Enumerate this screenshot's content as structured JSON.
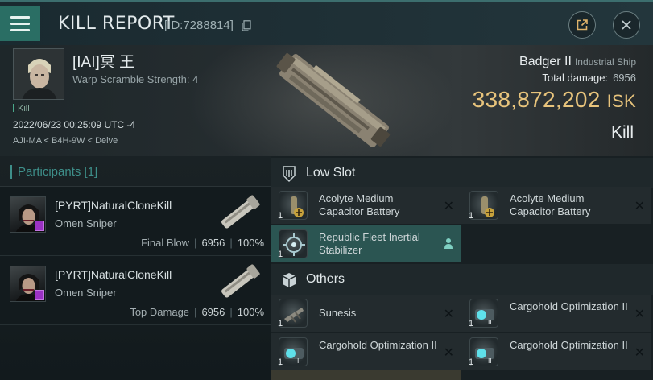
{
  "header": {
    "title": "KILL REPORT",
    "id_label": "[ID:7288814]"
  },
  "victim": {
    "name": "[IAI]冥 王",
    "subtitle": "Warp Scramble Strength: 4",
    "tag": "Kill",
    "date": "2022/06/23 00:25:09 UTC -4",
    "location": "AJI-MA < B4H-9W < Delve"
  },
  "ship": {
    "name": "Badger II",
    "class": "Industrial Ship",
    "total_damage_label": "Total damage:",
    "total_damage": "6956",
    "isk_value": "338,872,202",
    "isk_unit": "ISK",
    "result": "Kill"
  },
  "participants": {
    "header": "Participants [1]",
    "items": [
      {
        "name": "[PYRT]NaturalCloneKill",
        "ship": "Omen Sniper",
        "label": "Final Blow",
        "damage": "6956",
        "percent": "100%"
      },
      {
        "name": "[PYRT]NaturalCloneKill",
        "ship": "Omen Sniper",
        "label": "Top Damage",
        "damage": "6956",
        "percent": "100%"
      }
    ]
  },
  "fitting": {
    "low_slot": {
      "title": "Low Slot",
      "items": [
        {
          "name": "Acolyte Medium Capacitor Battery",
          "qty": "1"
        },
        {
          "name": "Acolyte Medium Capacitor Battery",
          "qty": "1"
        },
        {
          "name": "Republic Fleet Inertial Stabilizer",
          "qty": "1"
        }
      ]
    },
    "others": {
      "title": "Others",
      "items": [
        {
          "name": "Sunesis",
          "qty": "1"
        },
        {
          "name": "Cargohold Optimization II",
          "qty": "1"
        },
        {
          "name": "Cargohold Optimization II",
          "qty": "1"
        },
        {
          "name": "Cargohold Optimization II",
          "qty": "1"
        }
      ]
    }
  },
  "colors": {
    "accent": "#3e8f8a",
    "isk": "#e8c47c",
    "menu": "#2a6e64",
    "highlight_row": "#2b5552",
    "corp_badge": "#9b32c4"
  }
}
